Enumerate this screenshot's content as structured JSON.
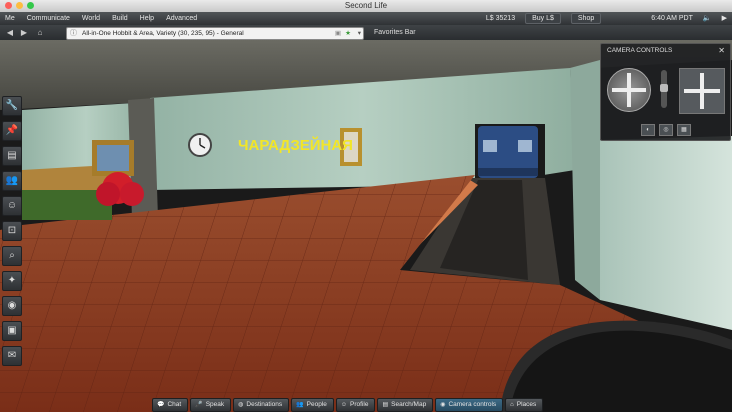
{
  "window": {
    "title": "Second Life"
  },
  "menubar": {
    "items": [
      "Me",
      "Communicate",
      "World",
      "Build",
      "Help",
      "Advanced"
    ],
    "balance": "L$ 35213",
    "buy_label": "Buy L$",
    "shop_label": "Shop",
    "clock": "6:40 AM PDT"
  },
  "navbar": {
    "location": "All-in-One Hobbit & Area, Variety (30, 235, 95) - General",
    "favorites_label": "Favorites Bar"
  },
  "scene": {
    "station_sign": "ЧАРАДЗЕЙНАЯ"
  },
  "camera_controls": {
    "title": "CAMERA CONTROLS"
  },
  "sidebar": {
    "icons": [
      "wrench-icon",
      "pin-icon",
      "map-icon",
      "people-icon",
      "avatar-icon",
      "camera-icon",
      "search-icon",
      "bulb-icon",
      "eye-icon",
      "snapshot-icon",
      "chat-icon"
    ]
  },
  "bottom_bar": {
    "buttons": [
      {
        "label": "Chat",
        "active": false
      },
      {
        "label": "Speak",
        "active": false
      },
      {
        "label": "Destinations",
        "active": false
      },
      {
        "label": "People",
        "active": false
      },
      {
        "label": "Profile",
        "active": false
      },
      {
        "label": "Search/Map",
        "active": false
      },
      {
        "label": "Camera controls",
        "active": true
      },
      {
        "label": "Places",
        "active": false
      }
    ]
  }
}
